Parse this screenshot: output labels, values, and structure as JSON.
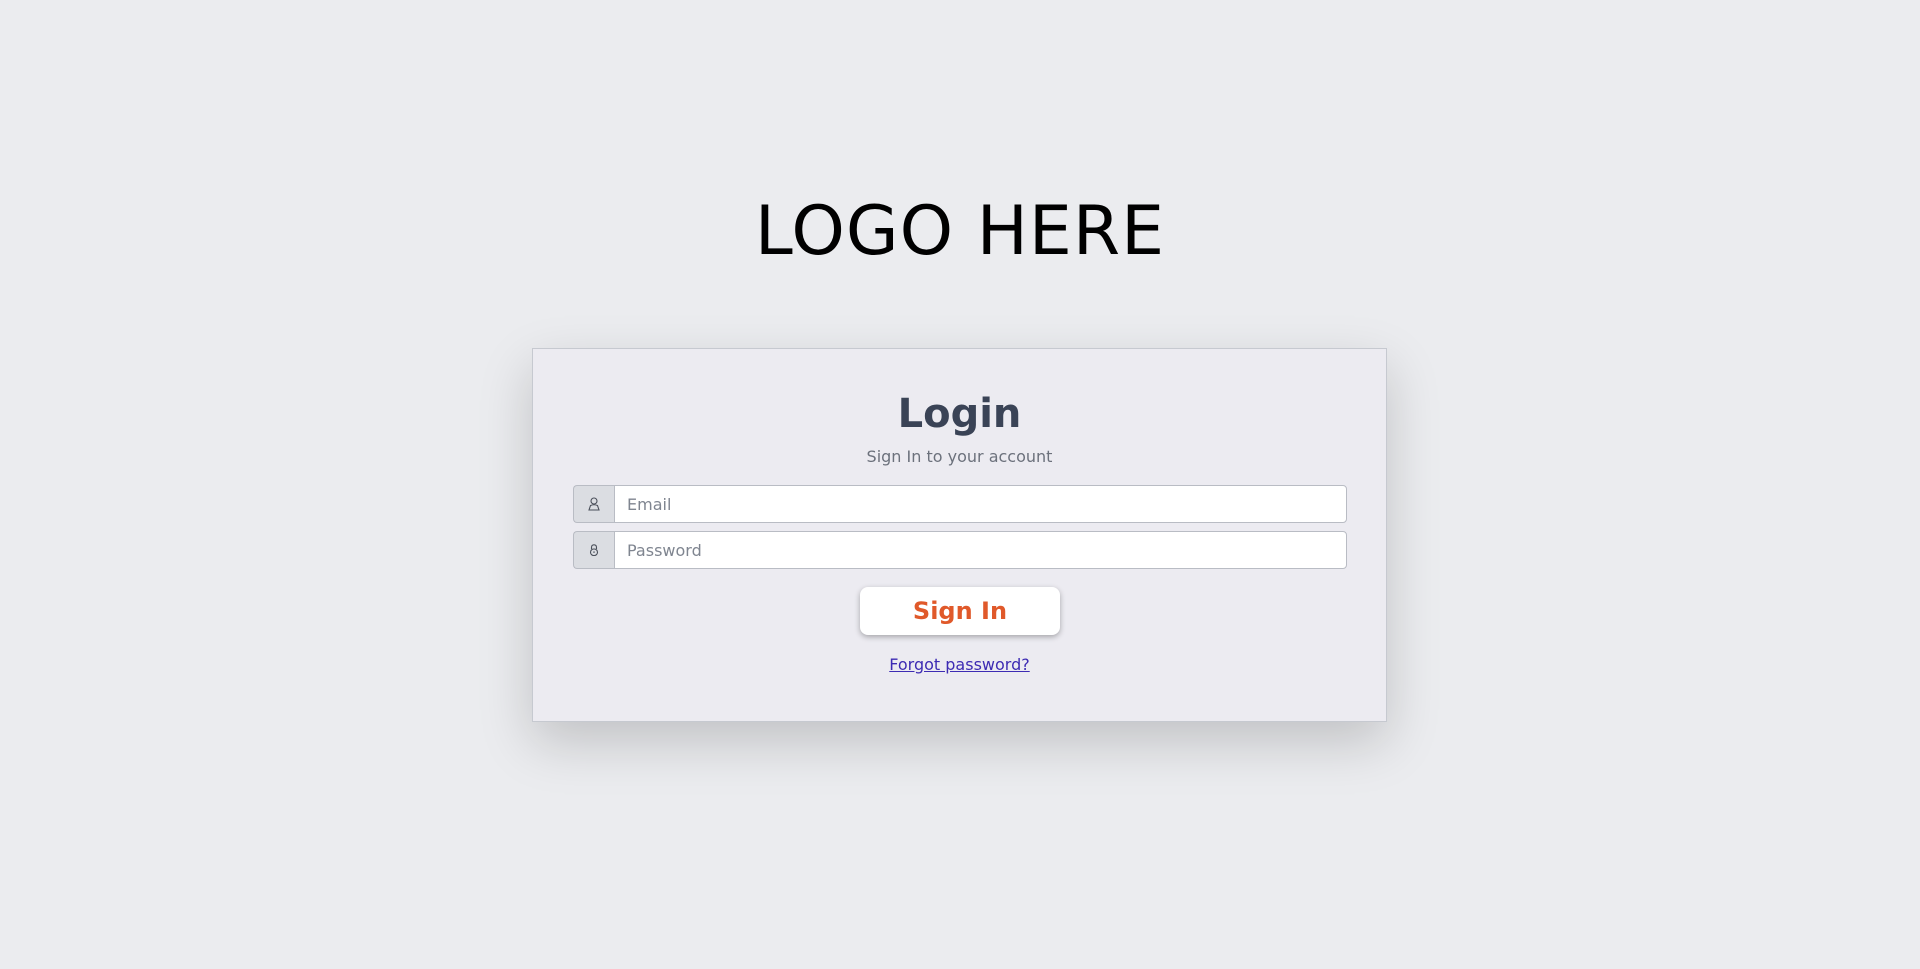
{
  "logo": {
    "text": "LOGO HERE"
  },
  "login": {
    "title": "Login",
    "subtitle": "Sign In to your account",
    "email": {
      "icon": "user-icon",
      "placeholder": "Email",
      "value": ""
    },
    "password": {
      "icon": "lock-icon",
      "placeholder": "Password",
      "value": ""
    },
    "signin_label": "Sign In",
    "forgot_label": "Forgot password?"
  },
  "colors": {
    "page_background": "#ebecef",
    "card_background": "#ecebf1",
    "title": "#3a4356",
    "button_text": "#e0592a",
    "link": "#3d2bb3"
  }
}
